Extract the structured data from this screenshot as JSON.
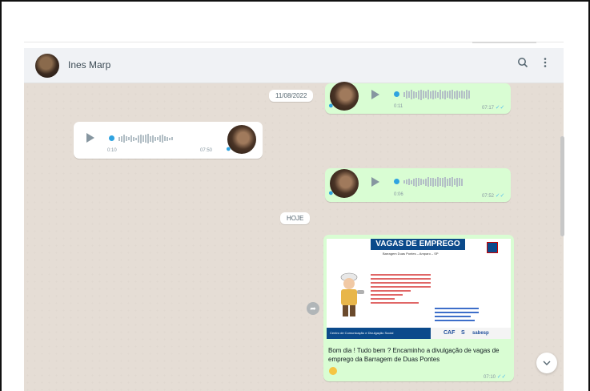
{
  "header": {
    "contact_name": "Ines Marp",
    "search_icon": "search-icon",
    "menu_icon": "kebab-menu-icon"
  },
  "dates": {
    "first": "11/08/2022",
    "today": "HOJE"
  },
  "messages": [
    {
      "type": "voice",
      "direction": "outgoing",
      "duration": "0:11",
      "time": "07:17"
    },
    {
      "type": "voice",
      "direction": "incoming",
      "duration": "0:10",
      "time": "07:50"
    },
    {
      "type": "voice",
      "direction": "outgoing",
      "duration": "0:06",
      "time": "07:52"
    },
    {
      "type": "image",
      "direction": "outgoing",
      "image_title": "VAGAS DE EMPREGO",
      "image_subtitle": "Barragem Duas Pontes – Amparo – SP",
      "image_footer": "Centro de Comunicação e Divulgação Social",
      "image_logos": [
        "CAF",
        "S",
        "sabesp"
      ],
      "caption": "Bom dia ! Tudo bem ? Encaminho a divulgação de vagas de emprego da Barragem de Duas Pontes",
      "time": "07:10"
    }
  ],
  "colors": {
    "outgoing_bubble": "#d9fdd3",
    "incoming_bubble": "#ffffff",
    "chat_background": "#e5ddd5",
    "read_tick": "#53bdeb",
    "voice_dot": "#2fa3e0"
  }
}
